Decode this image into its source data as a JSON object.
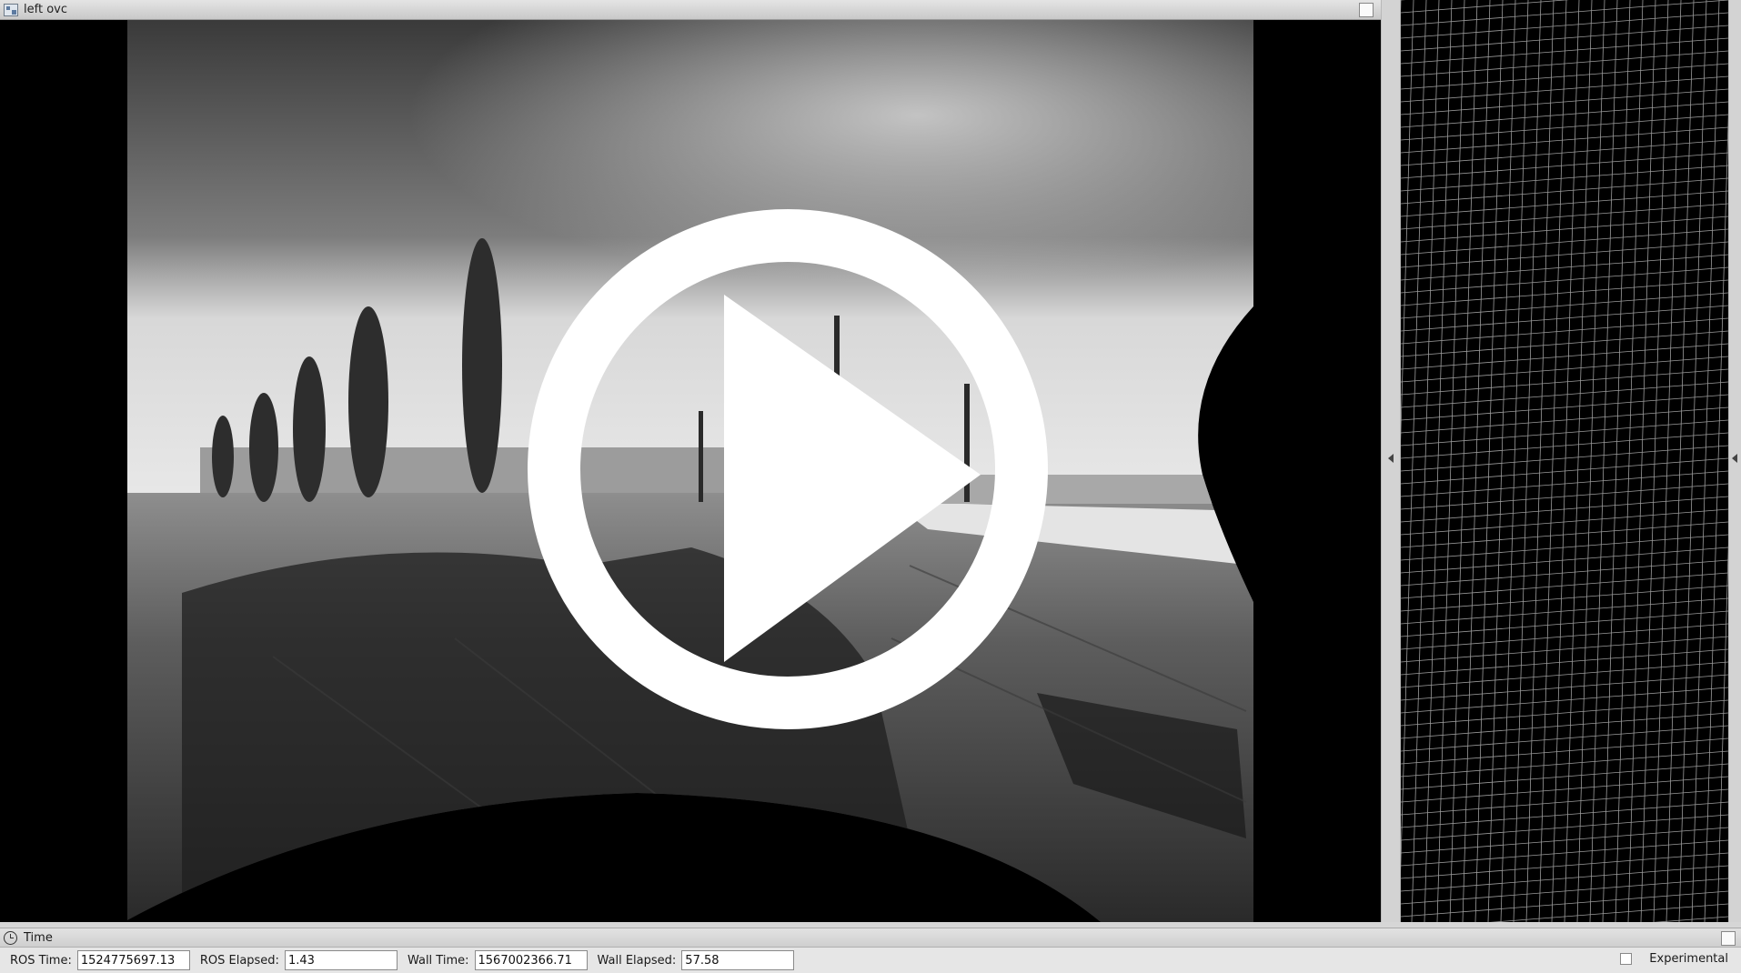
{
  "image_panel": {
    "title": "left ovc",
    "window_icon": "image-view-icon",
    "undock_icon": "undock-icon",
    "overlay_icon": "play-icon"
  },
  "splitter": {
    "icon": "collapse-left-arrow-icon"
  },
  "grid_view": {
    "grid_color": "#cfcfcf",
    "background": "#000000"
  },
  "time_panel": {
    "title": "Time",
    "icon": "clock-icon",
    "ros_time_label": "ROS Time:",
    "ros_time_value": "1524775697.13",
    "ros_elapsed_label": "ROS Elapsed:",
    "ros_elapsed_value": "1.43",
    "wall_time_label": "Wall Time:",
    "wall_time_value": "1567002366.71",
    "wall_elapsed_label": "Wall Elapsed:",
    "wall_elapsed_value": "57.58",
    "experimental_label": "Experimental",
    "experimental_checked": false
  }
}
